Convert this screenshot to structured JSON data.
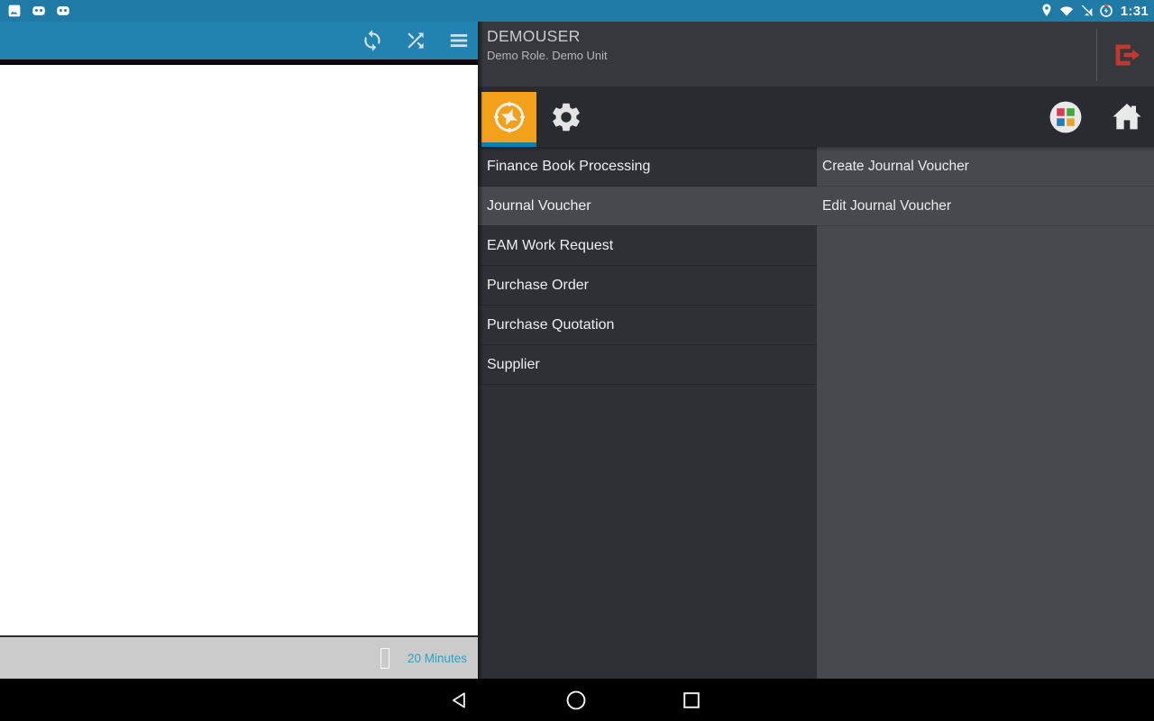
{
  "status_bar": {
    "time": "1:31",
    "icons_left": [
      "screenshot-icon",
      "robot-icon",
      "robot-icon"
    ],
    "icons_right": [
      "location-icon",
      "wifi-icon",
      "no-sim-icon",
      "battery-charging-icon"
    ]
  },
  "left_app": {
    "header_icons": [
      "sync-icon",
      "shuffle-icon",
      "menu-icon"
    ],
    "footer": {
      "duration_label": "20 Minutes"
    }
  },
  "drawer": {
    "header": {
      "username": "DEMOUSER",
      "role_unit": "Demo Role. Demo Unit"
    },
    "tabs": [
      {
        "name": "activities",
        "icon": "compass-icon",
        "selected": true
      },
      {
        "name": "settings",
        "icon": "gear-icon",
        "selected": false
      }
    ],
    "toolbar_right_icons": [
      "app-grid-icon",
      "home-icon"
    ],
    "menu_items": [
      {
        "label": "Finance Book Processing",
        "selected": false
      },
      {
        "label": "Journal Voucher",
        "selected": true
      },
      {
        "label": "EAM Work Request",
        "selected": false
      },
      {
        "label": "Purchase Order",
        "selected": false
      },
      {
        "label": "Purchase Quotation",
        "selected": false
      },
      {
        "label": "Supplier",
        "selected": false
      }
    ],
    "submenu_items": [
      {
        "label": "Create Journal Voucher"
      },
      {
        "label": "Edit Journal Voucher"
      }
    ]
  },
  "android_nav": {
    "buttons": [
      "back",
      "home",
      "recents"
    ]
  },
  "colors": {
    "status_bar_blue": "#1f7aa6",
    "app_header_blue": "#2283b0",
    "drawer_header_bg": "#35383d",
    "tab_bar_bg": "#282b2f",
    "active_tab_orange": "#f3a11a",
    "tab_indicator_blue": "#0d7fae",
    "menu_bg": "#2d3035",
    "selected_row_bg": "#47494e",
    "logout_red": "#c2372e",
    "timer_text_blue": "#2aa2c4",
    "footer_bar_gray": "#cbcbcb"
  }
}
